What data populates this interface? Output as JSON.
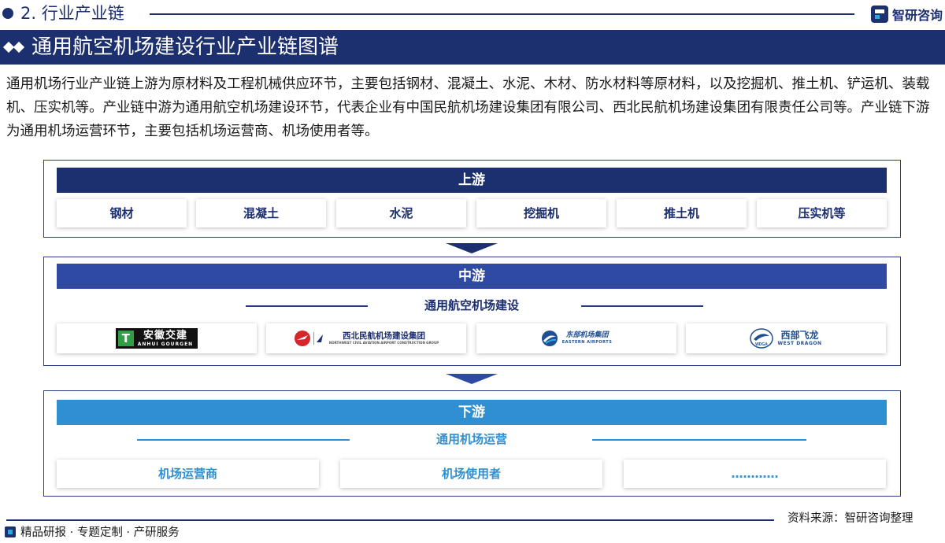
{
  "header": {
    "section_title": "2. 行业产业链",
    "brand_name": "智研咨询"
  },
  "title_band": {
    "title": "通用航空机场建设行业产业链图谱"
  },
  "description": "通用机场行业产业链上游为原材料及工程机械供应环节，主要包括钢材、混凝土、水泥、木材、防水材料等原材料，以及挖掘机、推土机、铲运机、装载机、压实机等。产业链中游为通用航空机场建设环节，代表企业有中国民航机场建设集团有限公司、西北民航机场建设集团有限责任公司等。产业链下游为通用机场运营环节，主要包括机场运营商、机场使用者等。",
  "upstream": {
    "label": "上游",
    "items": [
      "钢材",
      "混凝土",
      "水泥",
      "挖掘机",
      "推土机",
      "压实机等"
    ]
  },
  "midstream": {
    "label": "中游",
    "sublabel": "通用航空机场建设",
    "logos": [
      {
        "name_cn": "安徽交建",
        "name_en": "ANHUI GOURGEN",
        "icon": "anhui-jiaojian-logo"
      },
      {
        "name_cn": "西北民航机场建设集团",
        "name_en": "NORTHWEST CIVIL AVIATION AIRPORT CONSTRUCTION GROUP",
        "icon": "northwest-airport-construction-logo"
      },
      {
        "name_cn": "东部机场集团",
        "name_en": "EASTERN AIRPORTS",
        "icon": "eastern-airports-logo"
      },
      {
        "name_cn": "西部飞龙",
        "name_en": "WEST DRAGON",
        "icon": "west-dragon-logo"
      }
    ]
  },
  "downstream": {
    "label": "下游",
    "sublabel": "通用机场运营",
    "items": [
      "机场运营商",
      "机场使用者",
      "…………"
    ]
  },
  "footer": {
    "source": "资料来源：智研咨询整理",
    "slogan": "精品研报 · 专题定制 · 产研服务"
  },
  "colors": {
    "navy": "#1c2f6e",
    "mid_blue": "#2f4aa3",
    "light_blue": "#2f8fd1",
    "accent_cyan": "#29a8e0"
  }
}
